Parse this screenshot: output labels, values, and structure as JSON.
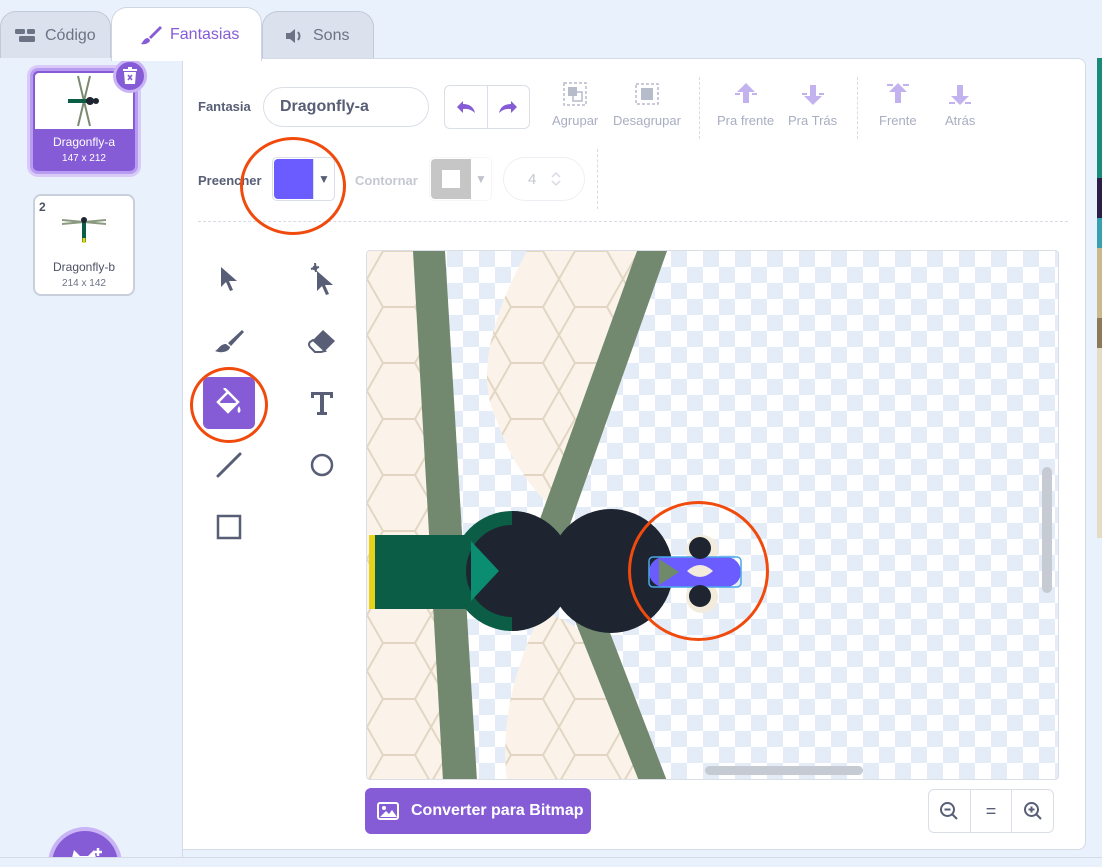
{
  "tabs": [
    {
      "label": "Código",
      "icon": "code-blocks-icon"
    },
    {
      "label": "Fantasias",
      "icon": "paintbrush-icon"
    },
    {
      "label": "Sons",
      "icon": "speaker-icon"
    }
  ],
  "costumes": [
    {
      "number": "1",
      "name": "Dragonfly-a",
      "size": "147 x 212",
      "selected": true
    },
    {
      "number": "2",
      "name": "Dragonfly-b",
      "size": "214 x 142",
      "selected": false
    }
  ],
  "toolbar": {
    "costume_label": "Fantasia",
    "costume_name": "Dragonfly-a",
    "group": "Agrupar",
    "ungroup": "Desagrupar",
    "forward": "Pra frente",
    "backward": "Pra Trás",
    "front": "Frente",
    "back": "Atrás",
    "fill_label": "Preencher",
    "outline_label": "Contornar",
    "stroke_width": "4"
  },
  "colors": {
    "accent": "#855cd6",
    "fill": "#6a5cff",
    "highlight_ring": "#f04a0d"
  },
  "tools": [
    "select-tool",
    "reshape-tool",
    "brush-tool",
    "eraser-tool",
    "fill-tool",
    "text-tool",
    "line-tool",
    "circle-tool",
    "rectangle-tool"
  ],
  "active_tool": "fill-tool",
  "bottom": {
    "convert_label": "Converter para Bitmap",
    "zoom_reset": "="
  }
}
